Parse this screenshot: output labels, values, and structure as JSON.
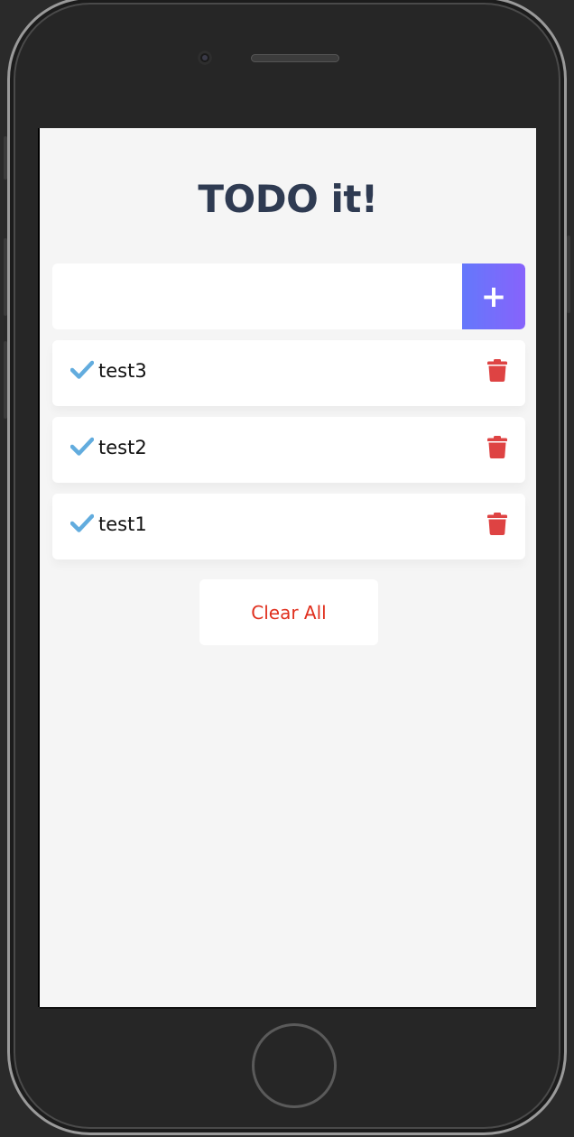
{
  "app": {
    "title": "TODO it!"
  },
  "input": {
    "value": "",
    "placeholder": ""
  },
  "add_button": {
    "label": "+",
    "icon": "plus-icon"
  },
  "todos": [
    {
      "text": "test3",
      "icon": "check-icon",
      "delete_icon": "trash-icon"
    },
    {
      "text": "test2",
      "icon": "check-icon",
      "delete_icon": "trash-icon"
    },
    {
      "text": "test1",
      "icon": "check-icon",
      "delete_icon": "trash-icon"
    }
  ],
  "clear_button": {
    "label": "Clear All"
  },
  "colors": {
    "title": "#2f3b52",
    "background": "#f5f5f5",
    "accent_start": "#6478fb",
    "accent_end": "#8763fb",
    "check": "#62acde",
    "trash": "#de4343",
    "clear": "#e0301e"
  }
}
